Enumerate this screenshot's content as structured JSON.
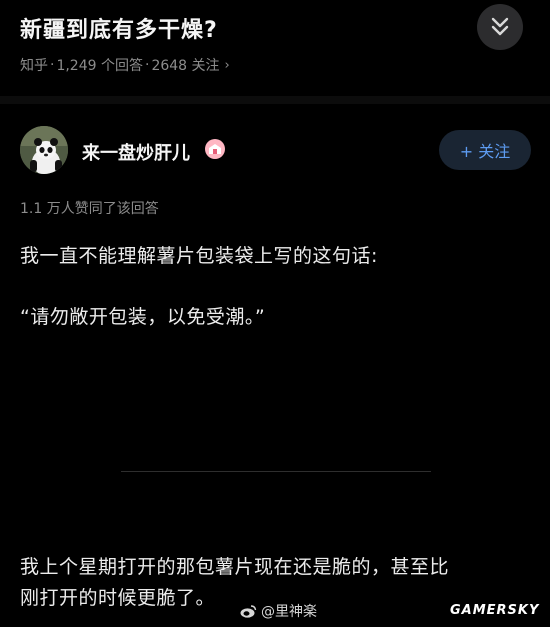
{
  "question": {
    "title": "新疆到底有多干燥?",
    "platform": "知乎",
    "answers": "1,249 个回答",
    "followers": "2648 关注",
    "sep1": "·",
    "sep2": "·",
    "chevron": "›"
  },
  "author": {
    "name": "来一盘炒肝儿",
    "follow_label": "+ 关注"
  },
  "answer": {
    "upvotes": "1.1 万人赞同了该回答",
    "paragraph1": "我一直不能理解薯片包装袋上写的这句话:",
    "paragraph2": "“请勿敞开包装，以免受潮。”",
    "paragraph3_line1": "我上个星期打开的那包薯片现在还是脆的，甚至比",
    "paragraph3_line2": "刚打开的时候更脆了。"
  },
  "watermarks": {
    "weibo_user": "@里神楽",
    "site": "GAMERSKY"
  },
  "colors": {
    "background": "#000000",
    "accent_blue": "#5d9bf0",
    "follow_bg": "#1a2533",
    "secondary_text": "#8c8c8c",
    "badge_pink": "#ffb7c3"
  },
  "icons": {
    "collapse": "double-chevron-down-icon",
    "badge": "verified-badge-icon",
    "weibo": "weibo-logo-icon"
  }
}
